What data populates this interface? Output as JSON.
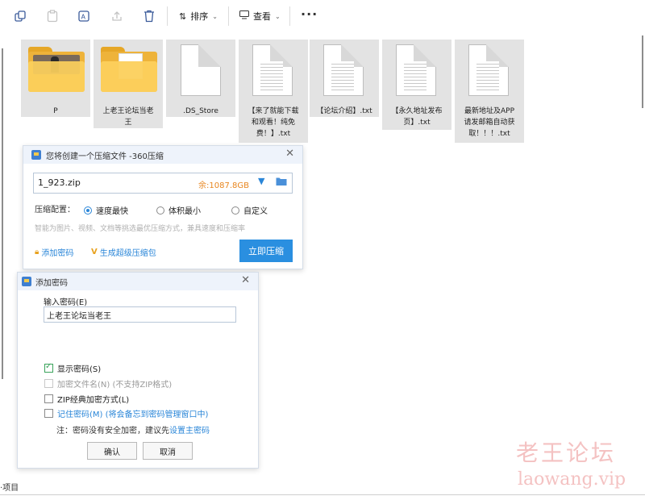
{
  "toolbar": {
    "sort_label": "排序",
    "view_label": "查看",
    "more_label": "···"
  },
  "files": [
    {
      "name_lines": [
        "P"
      ],
      "kind": "folder-photo"
    },
    {
      "name_lines": [
        "上老王论坛当老",
        "王"
      ],
      "kind": "folder-doc"
    },
    {
      "name_lines": [
        ".DS_Store"
      ],
      "kind": "file"
    },
    {
      "name_lines": [
        "【来了就能下载",
        "和观看！纯免",
        "费！】.txt"
      ],
      "kind": "text"
    },
    {
      "name_lines": [
        "【论坛介绍】.txt"
      ],
      "kind": "text"
    },
    {
      "name_lines": [
        "【永久地址发布",
        "页】.txt"
      ],
      "kind": "text"
    },
    {
      "name_lines": [
        "最新地址及APP",
        "请发邮箱自动获",
        "取！！！.txt"
      ],
      "kind": "text"
    }
  ],
  "compress_dialog": {
    "title": "您将创建一个压缩文件 -360压缩",
    "filename": "1_923.zip",
    "free_space": "余:1087.8GB",
    "config_label": "压缩配置：",
    "options": [
      "速度最快",
      "体积最小",
      "自定义"
    ],
    "selected_option": "速度最快",
    "hint": "智能为图片、视频、文档等挑选最优压缩方式，兼具速度和压缩率",
    "add_password_link": "添加密码",
    "super_pack_link": "生成超级压缩包",
    "compress_button": "立即压缩"
  },
  "password_dialog": {
    "title": "添加密码",
    "input_label": "输入密码(E)",
    "password_value": "上老王论坛当老王",
    "show_password": "显示密码(S)",
    "encrypt_names": "加密文件名(N) (不支持ZIP格式)",
    "zip_classic": "ZIP经典加密方式(L)",
    "remember": "记住密码(M) (将会备忘到密码管理窗口中)",
    "note_prefix": "注：密码没有安全加密，建议先",
    "note_link": "设置主密码",
    "ok_button": "确认",
    "cancel_button": "取消"
  },
  "status_bar": {
    "text": "·项目"
  },
  "watermark": {
    "line1": "老王论坛",
    "line2": "laowang.vip"
  }
}
